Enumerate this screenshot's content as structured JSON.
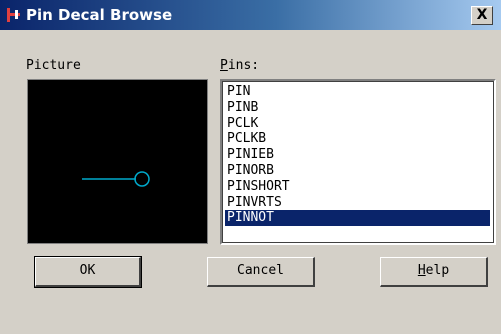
{
  "window": {
    "title": "Pin Decal Browse",
    "close_label": "X",
    "accent_color": "#0a246a"
  },
  "picture": {
    "label": "Picture",
    "background": "#000000",
    "line_color": "#00aacc"
  },
  "pins": {
    "label_mnemonic": "P",
    "label_rest": "ins:",
    "items": [
      "PIN",
      "PINB",
      "PCLK",
      "PCLKB",
      "PINIEB",
      "PINORB",
      "PINSHORT",
      "PINVRTS",
      "PINNOT"
    ],
    "selected": "PINNOT"
  },
  "buttons": {
    "ok": "OK",
    "cancel": "Cancel",
    "help_mnemonic": "H",
    "help_rest": "elp"
  }
}
